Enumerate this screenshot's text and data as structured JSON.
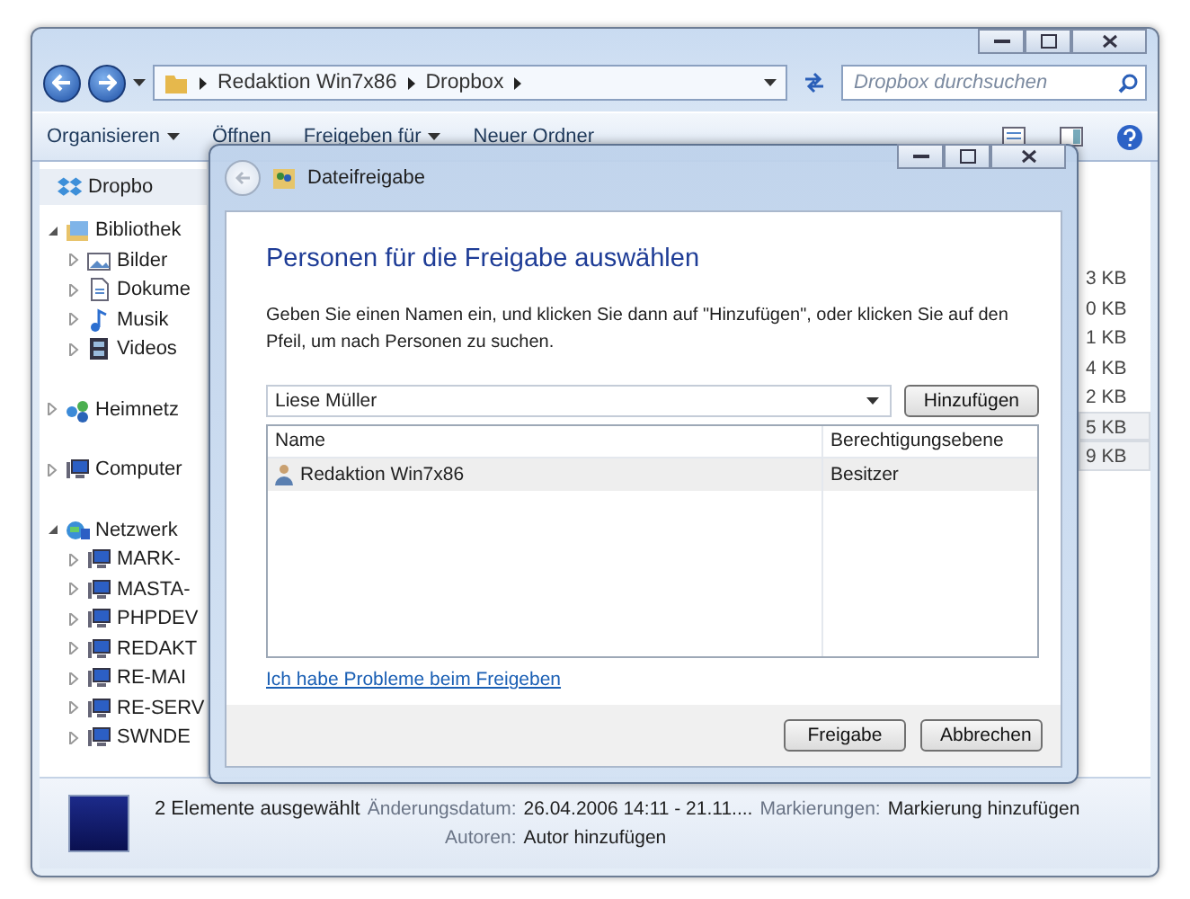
{
  "address_bar": {
    "segments": [
      "Redaktion Win7x86",
      "Dropbox"
    ]
  },
  "search": {
    "placeholder": "Dropbox durchsuchen"
  },
  "toolbar": [
    {
      "label": "Organisieren",
      "kind": "menu"
    },
    {
      "label": "Öffnen",
      "kind": "button"
    },
    {
      "label": "Freigeben für",
      "kind": "menu"
    },
    {
      "label": "Neuer Ordner",
      "kind": "button"
    }
  ],
  "sidebar": {
    "favorites": [
      {
        "label": "Dropbo",
        "kind": "dropbox"
      }
    ],
    "tree": [
      {
        "label": "Bibliothek",
        "kind": "library",
        "expanded": true,
        "children": [
          {
            "label": "Bilder",
            "kind": "pictures",
            "expanded": false
          },
          {
            "label": "Dokume",
            "kind": "documents",
            "expanded": false
          },
          {
            "label": "Musik",
            "kind": "music",
            "expanded": false
          },
          {
            "label": "Videos",
            "kind": "videos",
            "expanded": false
          }
        ]
      },
      {
        "label": "Heimnetz",
        "kind": "homegroup",
        "expanded": false
      },
      {
        "label": "Computer",
        "kind": "computer",
        "expanded": false
      },
      {
        "label": "Netzwerk",
        "kind": "network",
        "expanded": true,
        "children": [
          {
            "label": "MARK-",
            "kind": "computer",
            "expanded": false
          },
          {
            "label": "MASTA-",
            "kind": "computer",
            "expanded": false
          },
          {
            "label": "PHPDEV",
            "kind": "computer",
            "expanded": false
          },
          {
            "label": "REDAKT",
            "kind": "computer",
            "expanded": false
          },
          {
            "label": "RE-MAI",
            "kind": "computer",
            "expanded": false
          },
          {
            "label": "RE-SERV",
            "kind": "computer",
            "expanded": false
          },
          {
            "label": "SWNDE",
            "kind": "computer",
            "expanded": false
          }
        ]
      }
    ]
  },
  "file_sizes": [
    {
      "text": "3 KB",
      "selected": false
    },
    {
      "text": "0 KB",
      "selected": false
    },
    {
      "text": "1 KB",
      "selected": false
    },
    {
      "text": "4 KB",
      "selected": false
    },
    {
      "text": "2 KB",
      "selected": false
    },
    {
      "text": "5 KB",
      "selected": true
    },
    {
      "text": "9 KB",
      "selected": true
    }
  ],
  "dialog": {
    "title": "Dateifreigabe",
    "heading": "Personen für die Freigabe auswählen",
    "instructions": "Geben Sie einen Namen ein, und klicken Sie dann auf \"Hinzufügen\", oder klicken Sie auf den Pfeil, um nach Personen zu suchen.",
    "name_field": {
      "value": "Liese Müller"
    },
    "add_button": "Hinzufügen",
    "table": {
      "columns": [
        "Name",
        "Berechtigungsebene"
      ],
      "rows": [
        {
          "name": "Redaktion Win7x86",
          "permission": "Besitzer"
        }
      ]
    },
    "help_link": "Ich habe Probleme beim Freigeben",
    "buttons": [
      "Freigabe",
      "Abbrechen"
    ]
  },
  "status_bar": {
    "selection": "2 Elemente ausgewählt",
    "fields": [
      {
        "label": "Änderungsdatum:",
        "value": "26.04.2006 14:11 - 21.11...."
      },
      {
        "label": "Markierungen:",
        "value": "Markierung hinzufügen"
      },
      {
        "label": "Autoren:",
        "value": "Autor hinzufügen"
      }
    ]
  }
}
